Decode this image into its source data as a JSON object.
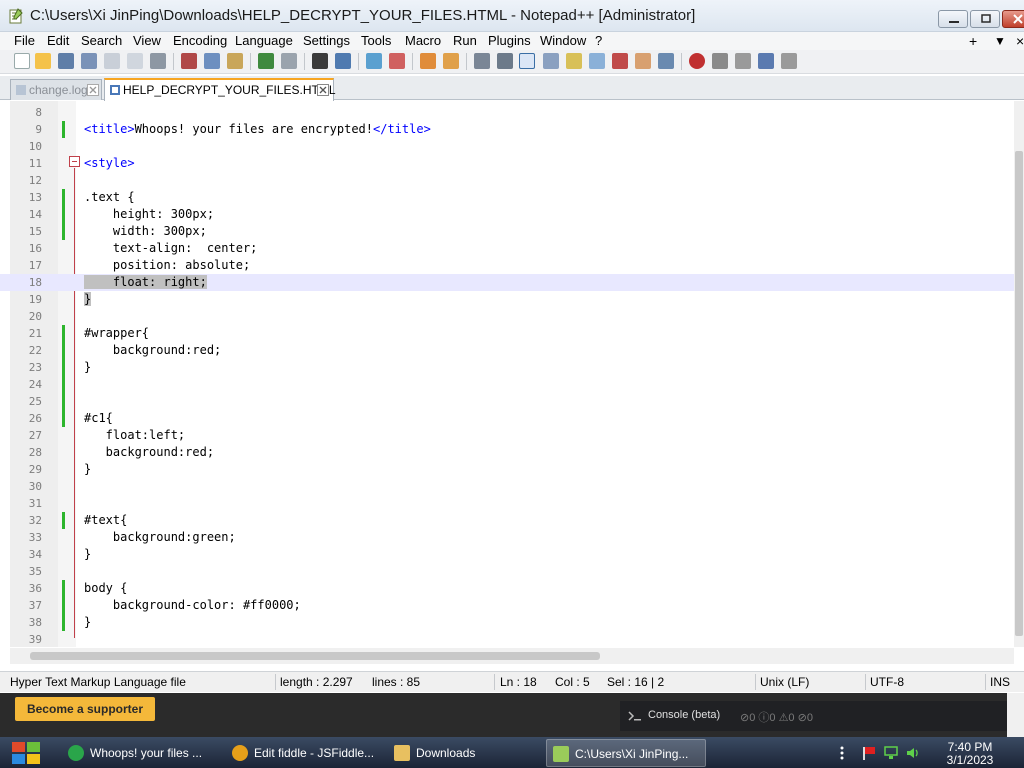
{
  "window": {
    "title": "C:\\Users\\Xi JinPing\\Downloads\\HELP_DECRYPT_YOUR_FILES.HTML - Notepad++ [Administrator]"
  },
  "menu": {
    "items": [
      "File",
      "Edit",
      "Search",
      "View",
      "Encoding",
      "Language",
      "Settings",
      "Tools",
      "Macro",
      "Run",
      "Plugins",
      "Window",
      "?"
    ],
    "right": [
      "+",
      "▼",
      "×"
    ]
  },
  "tabs": [
    {
      "label": "change.log",
      "active": false
    },
    {
      "label": "HELP_DECRYPT_YOUR_FILES.HTML",
      "active": true
    }
  ],
  "editor": {
    "current_line": 18,
    "lines": [
      {
        "n": "8",
        "text": ""
      },
      {
        "n": "9",
        "text": "<title>Whoops! your files are encrypted!</title>"
      },
      {
        "n": "10",
        "text": ""
      },
      {
        "n": "11",
        "text": "<style>"
      },
      {
        "n": "12",
        "text": ""
      },
      {
        "n": "13",
        "text": ".text {"
      },
      {
        "n": "14",
        "text": "    height: 300px;"
      },
      {
        "n": "15",
        "text": "    width: 300px;"
      },
      {
        "n": "16",
        "text": "    text-align:  center;"
      },
      {
        "n": "17",
        "text": "    position: absolute;"
      },
      {
        "n": "18",
        "text": "    float: right;"
      },
      {
        "n": "19",
        "text": "}"
      },
      {
        "n": "20",
        "text": ""
      },
      {
        "n": "21",
        "text": "#wrapper{"
      },
      {
        "n": "22",
        "text": "    background:red;"
      },
      {
        "n": "23",
        "text": "}"
      },
      {
        "n": "24",
        "text": ""
      },
      {
        "n": "25",
        "text": ""
      },
      {
        "n": "26",
        "text": "#c1{"
      },
      {
        "n": "27",
        "text": "   float:left;"
      },
      {
        "n": "28",
        "text": "   background:red;"
      },
      {
        "n": "29",
        "text": "}"
      },
      {
        "n": "30",
        "text": ""
      },
      {
        "n": "31",
        "text": ""
      },
      {
        "n": "32",
        "text": "#text{"
      },
      {
        "n": "33",
        "text": "    background:green;"
      },
      {
        "n": "34",
        "text": "}"
      },
      {
        "n": "35",
        "text": ""
      },
      {
        "n": "36",
        "text": "body {"
      },
      {
        "n": "37",
        "text": "    background-color: #ff0000;"
      },
      {
        "n": "38",
        "text": "}"
      },
      {
        "n": "39",
        "text": ""
      }
    ]
  },
  "status": {
    "file_type": "Hyper Text Markup Language file",
    "length": "length : 2.297",
    "lines": "lines : 85",
    "ln": "Ln : 18",
    "col": "Col : 5",
    "sel": "Sel : 16 | 2",
    "eol": "Unix (LF)",
    "encoding": "UTF-8",
    "mode": "INS"
  },
  "lower_panel": {
    "supporter_button": "Become a supporter",
    "console_label": "Console (beta)",
    "console_counts": "⊘0  ⓘ0  ⚠0  ⊘0"
  },
  "taskbar": {
    "items": [
      {
        "label": "Whoops! your files ...",
        "active": false,
        "color": "#2aa54a"
      },
      {
        "label": "Edit fiddle - JSFiddle...",
        "active": false,
        "color": "#e6a01a"
      },
      {
        "label": "Downloads",
        "active": false,
        "color": "#e8c060"
      },
      {
        "label": "C:\\Users\\Xi JinPing...",
        "active": true,
        "color": "#9acb5a"
      }
    ],
    "time": "7:40 PM",
    "date": "3/1/2023"
  },
  "colors": {
    "tag_blue": "#0000ff",
    "current_line": "#e8e8ff",
    "selection": "#c0c0c0",
    "change_marker": "#2db52d",
    "edge_line": "#e04545",
    "supporter_button": "#f4b83a"
  }
}
